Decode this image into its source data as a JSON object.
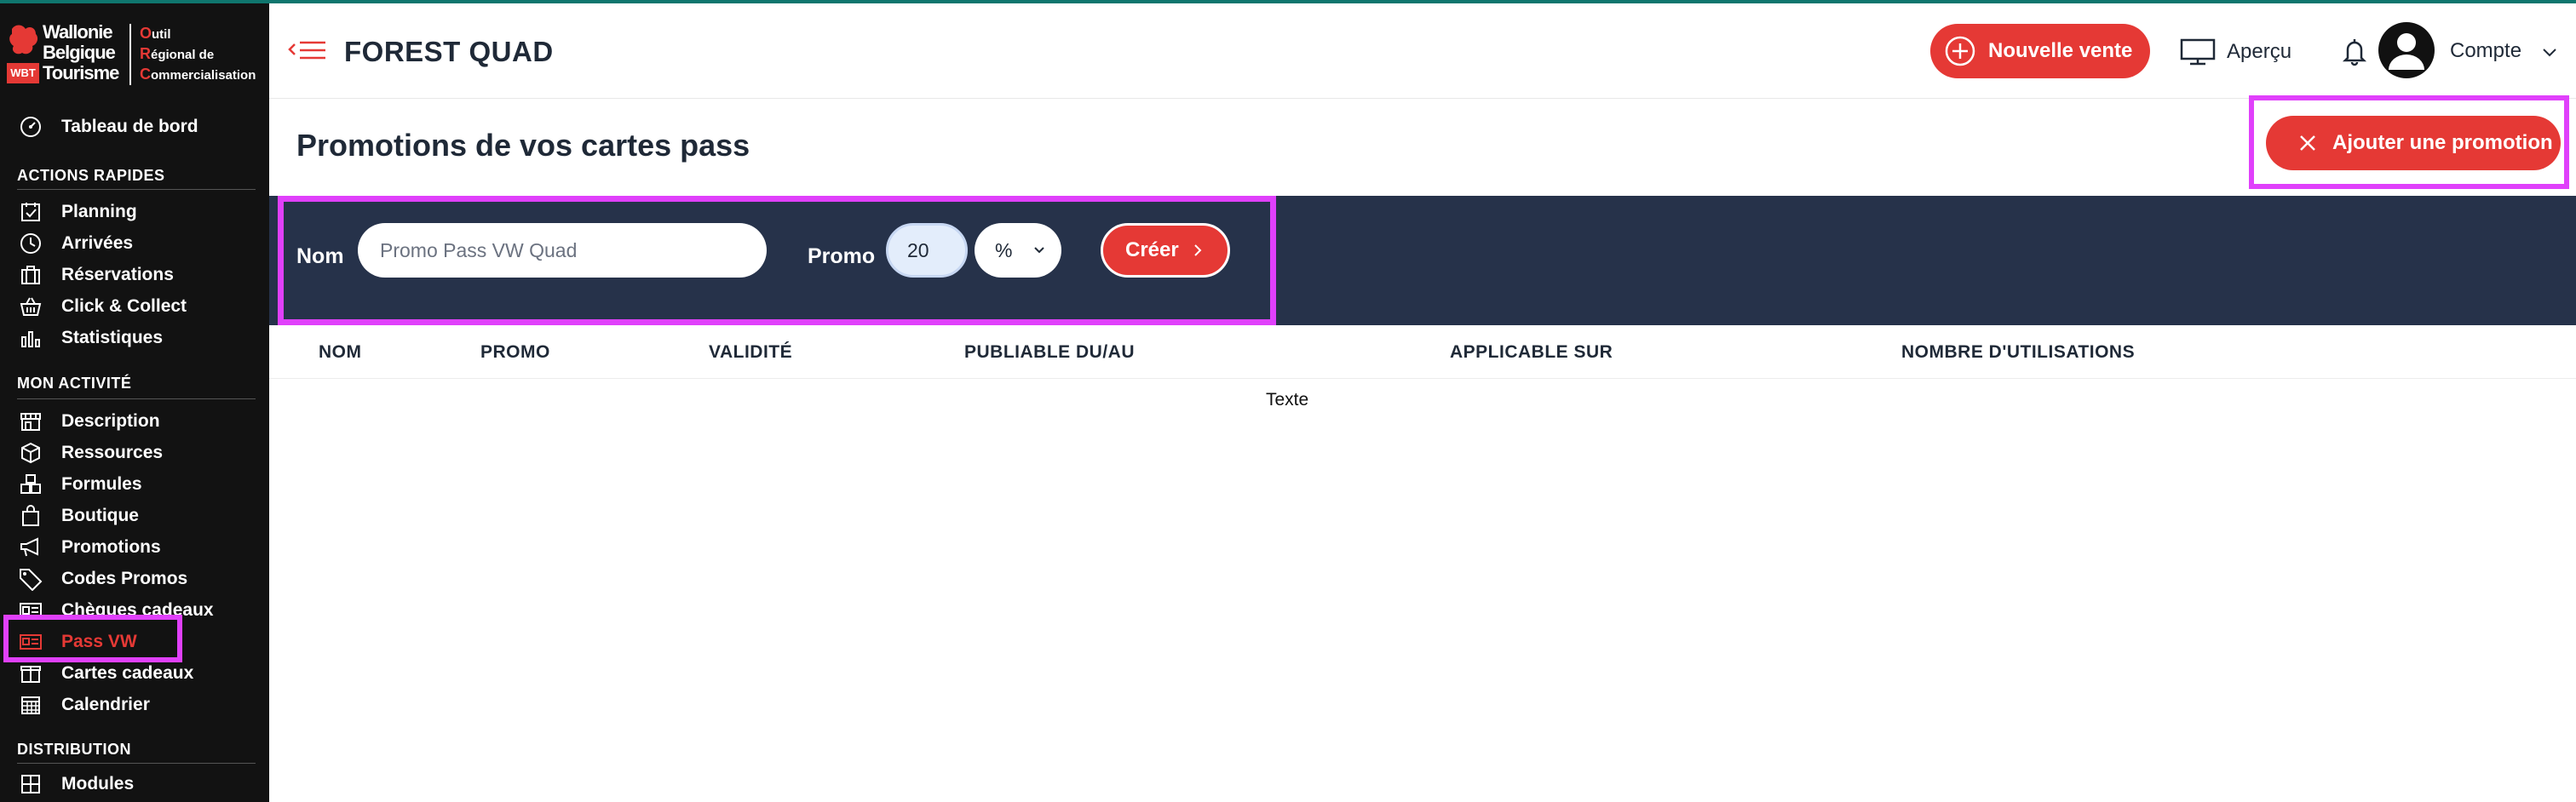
{
  "logo": {
    "brand_lines": [
      "Wallonie",
      "Belgique",
      "Tourisme"
    ],
    "badge": "WBT",
    "orc_lines": [
      {
        "cap": "O",
        "rest": "util"
      },
      {
        "cap": "R",
        "rest": "égional de"
      },
      {
        "cap": "C",
        "rest": "ommercialisation"
      }
    ]
  },
  "sidebar": {
    "dashboard": {
      "label": "Tableau de bord",
      "icon": "gauge-icon"
    },
    "sections": [
      {
        "title": "ACTIONS RAPIDES",
        "items": [
          {
            "label": "Planning",
            "icon": "calendar-check-icon"
          },
          {
            "label": "Arrivées",
            "icon": "clock-icon"
          },
          {
            "label": "Réservations",
            "icon": "suitcase-icon"
          },
          {
            "label": "Click & Collect",
            "icon": "basket-icon"
          },
          {
            "label": "Statistiques",
            "icon": "bar-chart-icon"
          }
        ]
      },
      {
        "title": "MON ACTIVITÉ",
        "items": [
          {
            "label": "Description",
            "icon": "storefront-icon"
          },
          {
            "label": "Ressources",
            "icon": "box-icon"
          },
          {
            "label": "Formules",
            "icon": "cubes-icon"
          },
          {
            "label": "Boutique",
            "icon": "shopping-bag-icon"
          },
          {
            "label": "Promotions",
            "icon": "megaphone-icon"
          },
          {
            "label": "Codes Promos",
            "icon": "tag-icon"
          },
          {
            "label": "Chèques cadeaux",
            "icon": "voucher-icon"
          },
          {
            "label": "Pass VW",
            "icon": "id-card-icon",
            "active": true
          },
          {
            "label": "Cartes cadeaux",
            "icon": "gift-icon"
          },
          {
            "label": "Calendrier",
            "icon": "calendar-grid-icon"
          }
        ]
      },
      {
        "title": "DISTRIBUTION",
        "items": [
          {
            "label": "Modules",
            "icon": "grid-icon"
          }
        ]
      }
    ]
  },
  "header": {
    "title": "FOREST QUAD",
    "new_sale_label": "Nouvelle vente",
    "preview_label": "Aperçu",
    "account_label": "Compte"
  },
  "page": {
    "title": "Promotions de vos cartes pass",
    "add_button_label": "Ajouter une promotion"
  },
  "form": {
    "name_label": "Nom",
    "name_placeholder": "Promo Pass VW Quad",
    "promo_label": "Promo",
    "promo_value": "20",
    "unit_value": "%",
    "create_label": "Créer"
  },
  "table": {
    "columns": [
      "NOM",
      "PROMO",
      "VALIDITÉ",
      "PUBLIABLE DU/AU",
      "APPLICABLE SUR",
      "NOMBRE D'UTILISATIONS"
    ],
    "empty_text": "Texte"
  },
  "colors": {
    "accent": "#e53935",
    "sidebar_bg": "#121212",
    "form_bar_bg": "#26324a",
    "highlight": "#e040fb"
  }
}
